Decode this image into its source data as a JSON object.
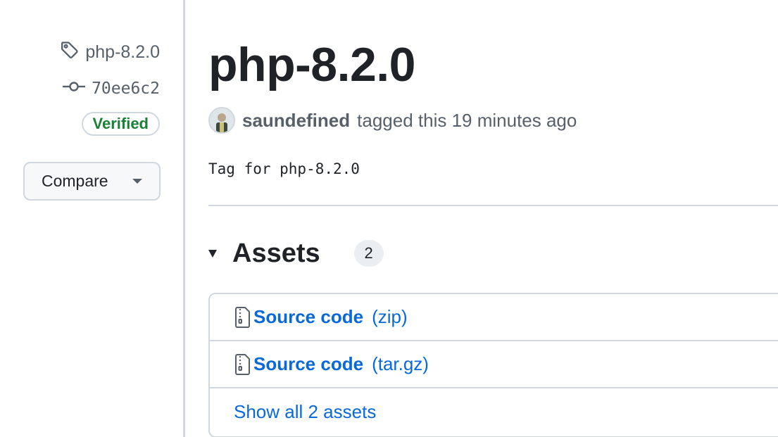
{
  "sidebar": {
    "tag_name": "php-8.2.0",
    "commit_sha": "70ee6c2",
    "verified_label": "Verified",
    "compare_label": "Compare"
  },
  "release": {
    "title": "php-8.2.0",
    "author": "saundefined",
    "action_text": "tagged this 19 minutes ago",
    "message": "Tag for php-8.2.0"
  },
  "assets": {
    "label": "Assets",
    "count": "2",
    "items": [
      {
        "name": "Source code",
        "ext": "(zip)"
      },
      {
        "name": "Source code",
        "ext": "(tar.gz)"
      }
    ],
    "show_all_label": "Show all 2 assets"
  },
  "colors": {
    "link": "#0969da",
    "verified": "#1a7f37",
    "border": "#d0d7de",
    "muted_text": "#57606a"
  }
}
